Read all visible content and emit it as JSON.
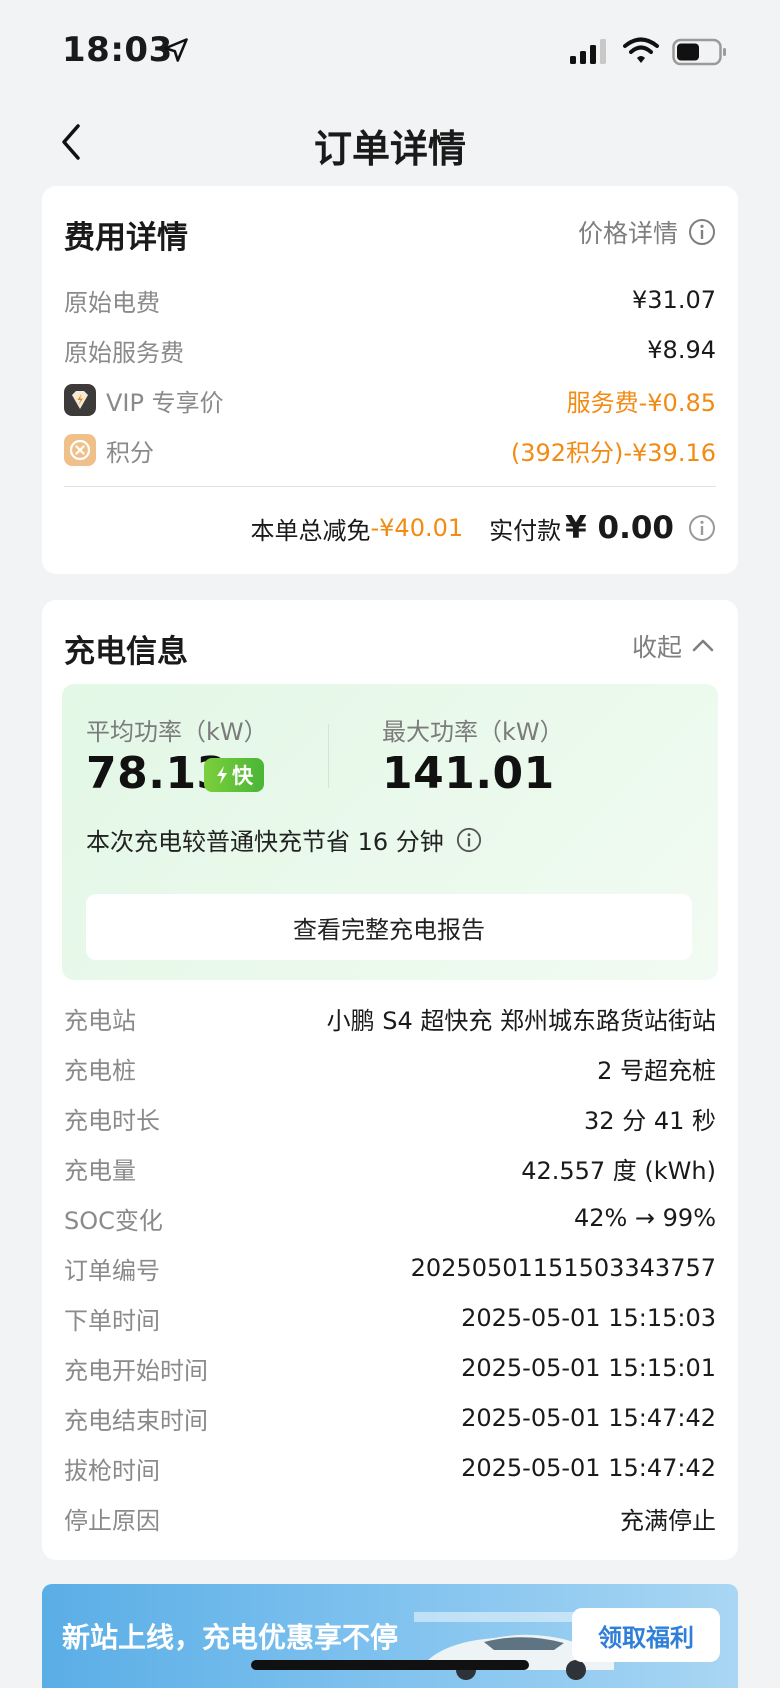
{
  "status_bar": {
    "time": "18:03"
  },
  "nav": {
    "title": "订单详情"
  },
  "fee": {
    "title": "费用详情",
    "price_detail_label": "价格详情",
    "rows": [
      {
        "label": "原始电费",
        "value": "¥31.07"
      },
      {
        "label": "原始服务费",
        "value": "¥8.94"
      },
      {
        "label": "VIP 专享价",
        "value": "服务费-¥0.85"
      },
      {
        "label": "积分",
        "value": "(392积分)-¥39.16"
      }
    ],
    "total_discount_label": "本单总减免",
    "total_discount_value": "-¥40.01",
    "paid_label": "实付款",
    "paid_value": "¥ 0.00"
  },
  "charge": {
    "title": "充电信息",
    "collapse_label": "收起",
    "avg_power_label": "平均功率（kW）",
    "avg_power_value": "78.13",
    "fast_badge": "快",
    "max_power_label": "最大功率（kW）",
    "max_power_value": "141.01",
    "save_text": "本次充电较普通快充节省 16 分钟",
    "report_button": "查看完整充电报告",
    "rows": [
      {
        "label": "充电站",
        "value": "小鹏 S4 超快充 郑州城东路货站街站"
      },
      {
        "label": "充电桩",
        "value": "2 号超充桩"
      },
      {
        "label": "充电时长",
        "value": "32 分 41 秒"
      },
      {
        "label": "充电量",
        "value": "42.557 度 (kWh)"
      },
      {
        "label": "SOC变化",
        "value": "42% → 99%"
      },
      {
        "label": "订单编号",
        "value": "20250501151503343757"
      },
      {
        "label": "下单时间",
        "value": "2025-05-01 15:15:03"
      },
      {
        "label": "充电开始时间",
        "value": "2025-05-01 15:15:01"
      },
      {
        "label": "充电结束时间",
        "value": "2025-05-01 15:47:42"
      },
      {
        "label": "拔枪时间",
        "value": "2025-05-01 15:47:42"
      },
      {
        "label": "停止原因",
        "value": "充满停止"
      }
    ]
  },
  "banner": {
    "text": "新站上线，充电优惠享不停",
    "button": "领取福利"
  },
  "colors": {
    "accent_orange": "#f28b13",
    "background": "#f2f3f5",
    "fast_green": "#4ab536"
  }
}
